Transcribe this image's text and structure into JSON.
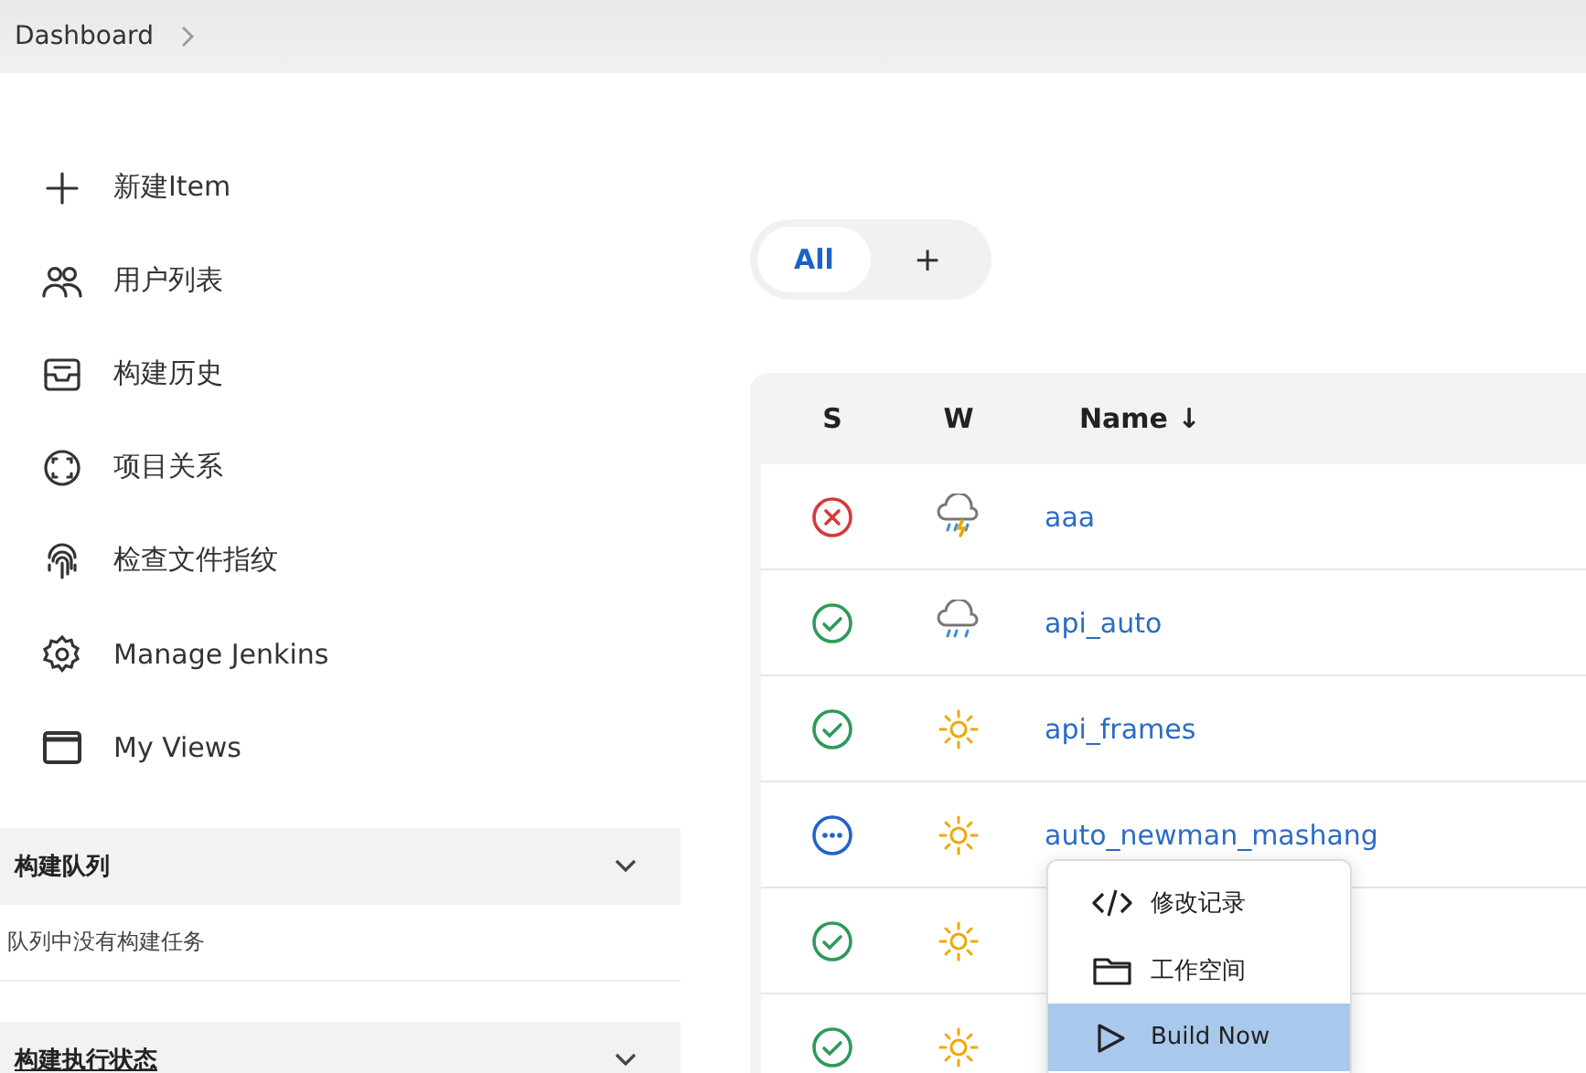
{
  "breadcrumb": {
    "items": [
      "Dashboard"
    ]
  },
  "sidebar": {
    "items": [
      {
        "label": "新建Item"
      },
      {
        "label": "用户列表"
      },
      {
        "label": "构建历史"
      },
      {
        "label": "项目关系"
      },
      {
        "label": "检查文件指纹"
      },
      {
        "label": "Manage Jenkins"
      },
      {
        "label": "My Views"
      }
    ]
  },
  "build_queue": {
    "title": "构建队列",
    "expanded": true,
    "message": "队列中没有构建任务"
  },
  "executor_status": {
    "title": "构建执行状态",
    "expanded": true
  },
  "tabs": [
    {
      "label": "All",
      "selected": true
    },
    {
      "label": "+",
      "selected": false
    }
  ],
  "table": {
    "columns": [
      "S",
      "W",
      "Name ↓"
    ],
    "rows": [
      {
        "kind": "failed",
        "weather": {
          "kind": "storm"
        },
        "name": "aaa"
      },
      {
        "kind": "success",
        "weather": {
          "kind": "rain"
        },
        "name": "api_auto"
      },
      {
        "kind": "success",
        "weather": {
          "kind": "sunny"
        },
        "name": "api_frames"
      },
      {
        "kind": "running",
        "weather": {
          "kind": "sunny"
        },
        "name": "auto_newman_mashang"
      },
      {
        "kind": "success",
        "weather": {
          "kind": "sunny"
        }
      },
      {
        "kind": "success",
        "weather": {
          "kind": "sunny"
        }
      }
    ]
  },
  "context_menu": {
    "items": [
      {
        "label": "修改记录",
        "selected": false
      },
      {
        "label": "工作空间",
        "selected": false
      },
      {
        "label": "Build Now",
        "selected": true
      }
    ]
  }
}
